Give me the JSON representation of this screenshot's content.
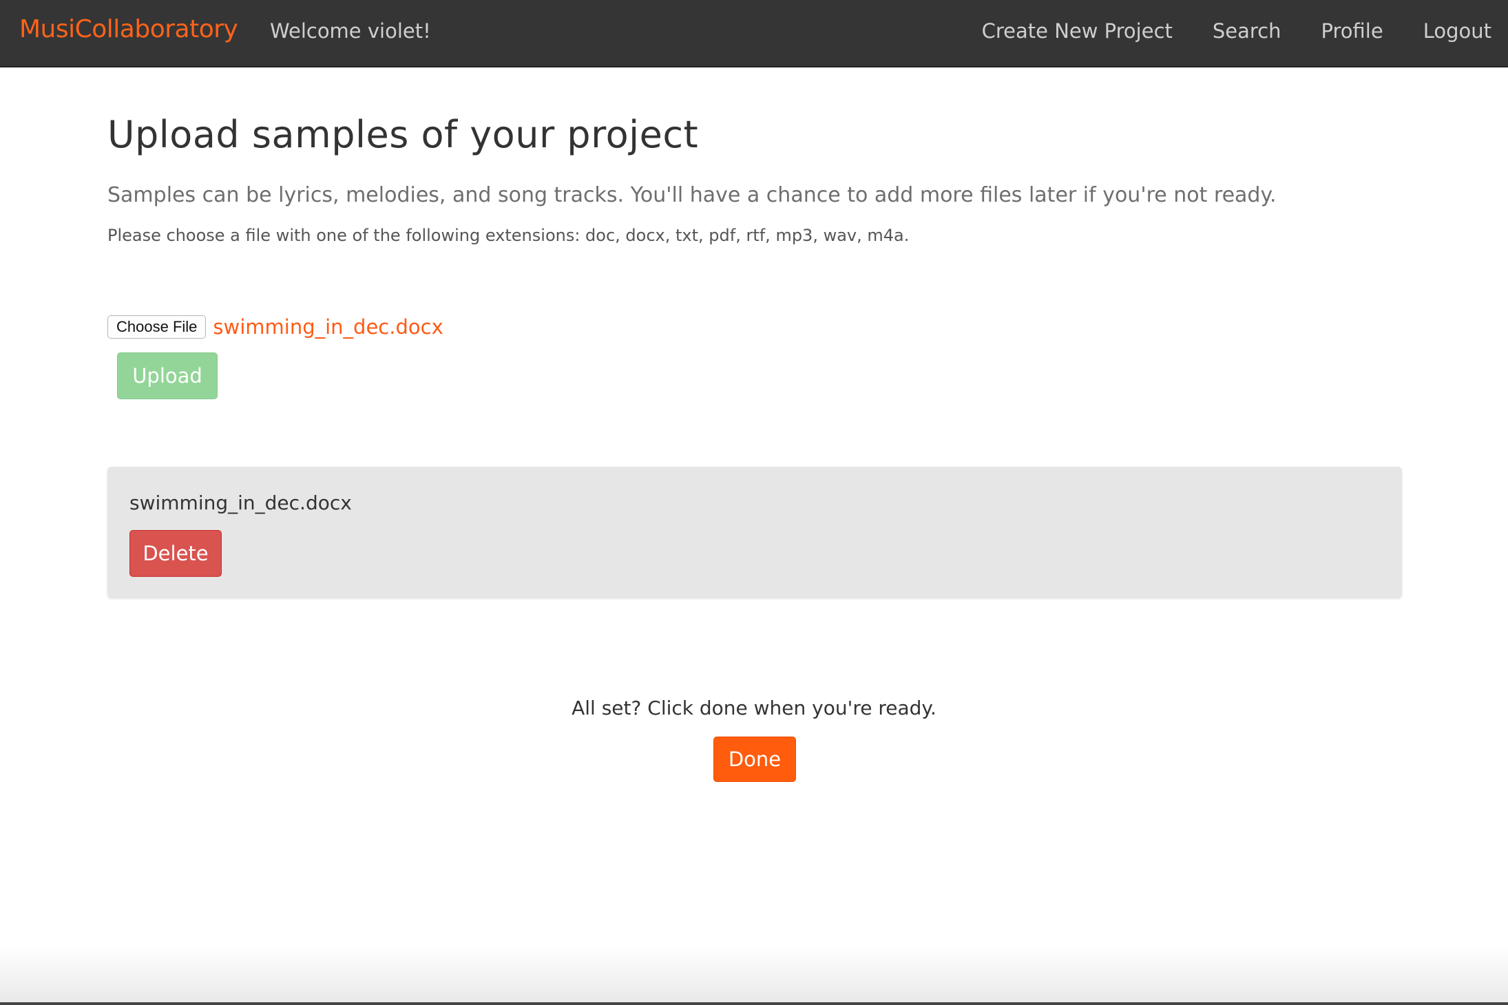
{
  "navbar": {
    "brand": "MusiCollaboratory",
    "welcome": "Welcome violet!",
    "links": {
      "create": "Create New Project",
      "search": "Search",
      "profile": "Profile",
      "logout": "Logout"
    }
  },
  "main": {
    "title": "Upload samples of your project",
    "lead": "Samples can be lyrics, melodies, and song tracks. You'll have a chance to add more files later if you're not ready.",
    "extensions_note": "Please choose a file with one of the following extensions: doc, docx, txt, pdf, rtf, mp3, wav, m4a.",
    "file_input": {
      "button_label": "Choose File",
      "selected_file": "swimming_in_dec.docx"
    },
    "upload_label": "Upload",
    "uploaded_files": [
      {
        "name": "swimming_in_dec.docx",
        "delete_label": "Delete"
      }
    ],
    "ready_text": "All set? Click done when you're ready.",
    "done_label": "Done"
  },
  "colors": {
    "brand": "#ff6319",
    "navbar_bg": "#353535",
    "upload_disabled": "#93d598",
    "delete": "#d9534f",
    "done": "#ff5c0d"
  }
}
